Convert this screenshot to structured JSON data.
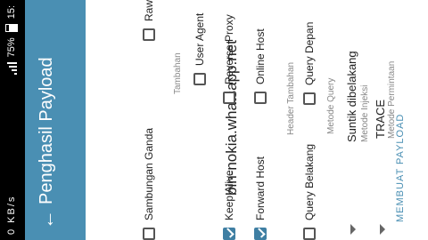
{
  "status": {
    "left": "0 KB/s",
    "battery_percent": "75%",
    "time": "15:"
  },
  "appbar": {
    "title": "Penghasil Payload"
  },
  "host": "bin-nokia.whatsapp.net",
  "sections": {
    "request_method": {
      "label": "Metode Permintaan",
      "value": "TRACE"
    },
    "injection_method": {
      "label": "Metode Injeksi",
      "value": "Suntik dibelakang"
    },
    "query_method": {
      "label": "Metode Query",
      "options": [
        {
          "label": "Query Depan",
          "checked": false
        },
        {
          "label": "Query Belakang",
          "checked": false
        }
      ]
    },
    "extra_header": {
      "label": "Header Tambahan",
      "options": [
        {
          "label": "Online Host",
          "checked": false
        },
        {
          "label": "Forward Host",
          "checked": true
        },
        {
          "label": "Reverse Proxy",
          "checked": false
        },
        {
          "label": "Keep Alive",
          "checked": true
        },
        {
          "label": "User Agent",
          "checked": false
        }
      ]
    },
    "extras": {
      "label": "Tambahan",
      "options": [
        {
          "label": "Raw",
          "checked": false
        },
        {
          "label": "Sambungan Ganda",
          "checked": false
        }
      ]
    }
  },
  "cta": "MEMBUAT PAYLOAD",
  "colors": {
    "primary": "#4a8fb3",
    "checkbox_on": "#3f7fa3"
  }
}
